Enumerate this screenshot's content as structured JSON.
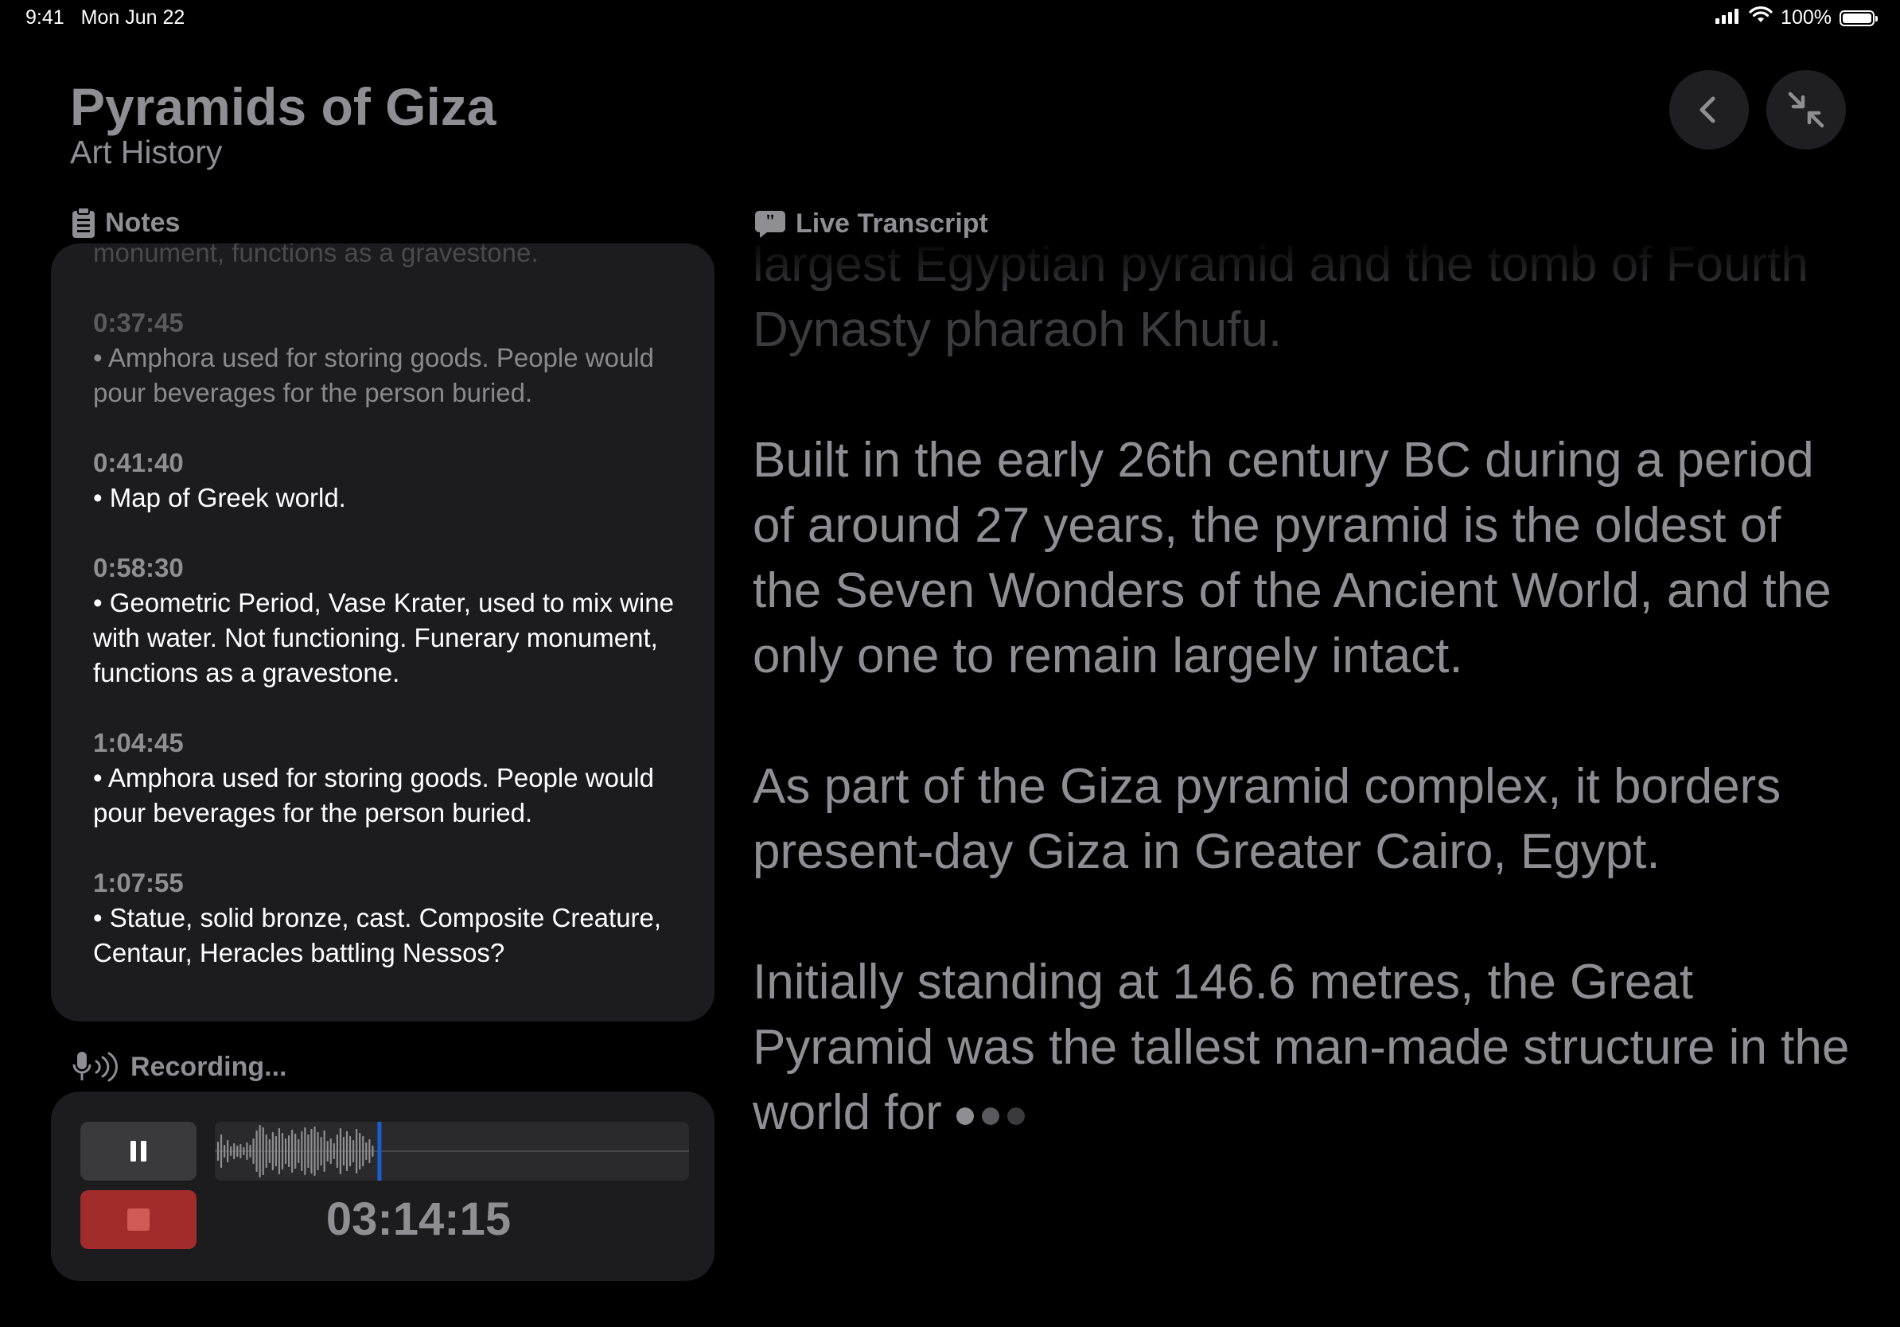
{
  "status_bar": {
    "time": "9:41",
    "date": "Mon Jun 22",
    "battery": "100%"
  },
  "header": {
    "title": "Pyramids of Giza",
    "subtitle": "Art History"
  },
  "notes": {
    "label": "Notes",
    "items": [
      {
        "time": "",
        "text": "monument, functions as a gravestone."
      },
      {
        "time": "0:37:45",
        "text": "• Amphora used for storing goods. People would pour beverages for the person buried."
      },
      {
        "time": "0:41:40",
        "text": "• Map of Greek world."
      },
      {
        "time": "0:58:30",
        "text": "• Geometric Period, Vase Krater, used to mix wine with water. Not functioning. Funerary monument, functions as a gravestone."
      },
      {
        "time": "1:04:45",
        "text": "• Amphora used for storing goods. People would pour beverages for the person buried."
      },
      {
        "time": "1:07:55",
        "text": "• Statue, solid bronze, cast. Composite Creature, Centaur, Heracles battling Nessos?"
      }
    ]
  },
  "recording": {
    "label": "Recording...",
    "timer": "03:14:15",
    "progress_color": "#1a5fd1"
  },
  "transcript": {
    "label": "Live Transcript",
    "paragraphs": [
      "largest Egyptian pyramid and the tomb of Fourth Dynasty pharaoh Khufu.",
      "Built in the early 26th century BC during a period of around 27 years, the pyramid is the oldest of the Seven Wonders of the Ancient World, and the only one to remain largely intact.",
      "As part of the Giza pyramid complex, it borders present-day Giza in Greater Cairo, Egypt.",
      "Initially standing at 146.6 metres, the Great Pyramid was the tallest man-made structure in the world for"
    ]
  },
  "colors": {
    "background": "#000000",
    "card": "#1c1c1e",
    "stop": "#a22c2b",
    "secondary_text": "#8e8e93"
  }
}
